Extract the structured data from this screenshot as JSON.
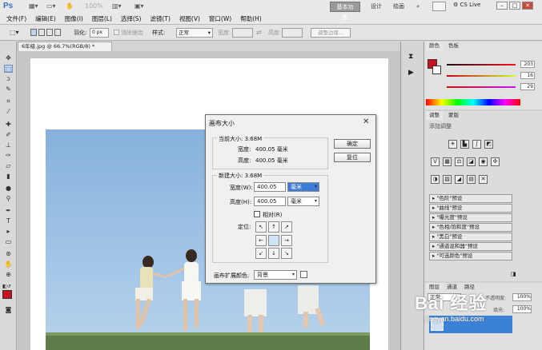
{
  "app": {
    "logo": "Ps",
    "menus": [
      "文件(F)",
      "编辑(E)",
      "图像(I)",
      "图层(L)",
      "选择(S)",
      "滤镜(T)",
      "视图(V)",
      "窗口(W)",
      "帮助(H)"
    ],
    "zoom": "100%",
    "workspaces": [
      "基本功能",
      "设计",
      "绘画"
    ],
    "cs_live": "CS Live"
  },
  "options_bar": {
    "feather_label": "羽化:",
    "feather_value": "0 px",
    "antialias_label": "消除锯齿",
    "style_label": "样式:",
    "style_value": "正常",
    "width_label": "宽度:",
    "height_label": "高度:",
    "refine_button": "调整边缘..."
  },
  "document": {
    "tab_title": "6年级.jpg @ 66.7%(RGB/8) *"
  },
  "dialog": {
    "title": "画布大小",
    "current_size_label": "当前大小: 3.68M",
    "current_width_label": "宽度:",
    "current_width_value": "400.05 毫米",
    "current_height_label": "高度:",
    "current_height_value": "400.05 毫米",
    "new_size_label": "新建大小: 3.68M",
    "width_label": "宽度(W):",
    "width_value": "400.05",
    "width_unit": "毫米",
    "height_label": "高度(H):",
    "height_value": "400.05",
    "height_unit": "毫米",
    "relative_label": "相对(R)",
    "anchor_label": "定位:",
    "ext_color_label": "画布扩展颜色:",
    "ext_color_value": "背景",
    "ok_button": "确定",
    "cancel_button": "复位"
  },
  "color_panel": {
    "tabs": [
      "颜色",
      "色板"
    ],
    "r": "203",
    "g": "16",
    "b": "29",
    "foreground_color": "#cb101d"
  },
  "adjust_panel": {
    "tabs": [
      "调整",
      "蒙版"
    ],
    "subtitle": "添加调整",
    "presets": [
      "\"色阶\"预设",
      "\"曲线\"预设",
      "\"曝光度\"预设",
      "\"色相/饱和度\"预设",
      "\"黑白\"预设",
      "\"通道混和器\"预设",
      "\"可选颜色\"预设"
    ]
  },
  "layers_panel": {
    "tabs": [
      "图层",
      "通道",
      "路径"
    ],
    "blend_mode": "正常",
    "opacity_label": "不透明度:",
    "opacity_value": "100%",
    "fill_label": "填充:",
    "fill_value": "100%"
  },
  "watermark": {
    "text": "Bai 经验",
    "url": "jingyan.baidu.com"
  }
}
